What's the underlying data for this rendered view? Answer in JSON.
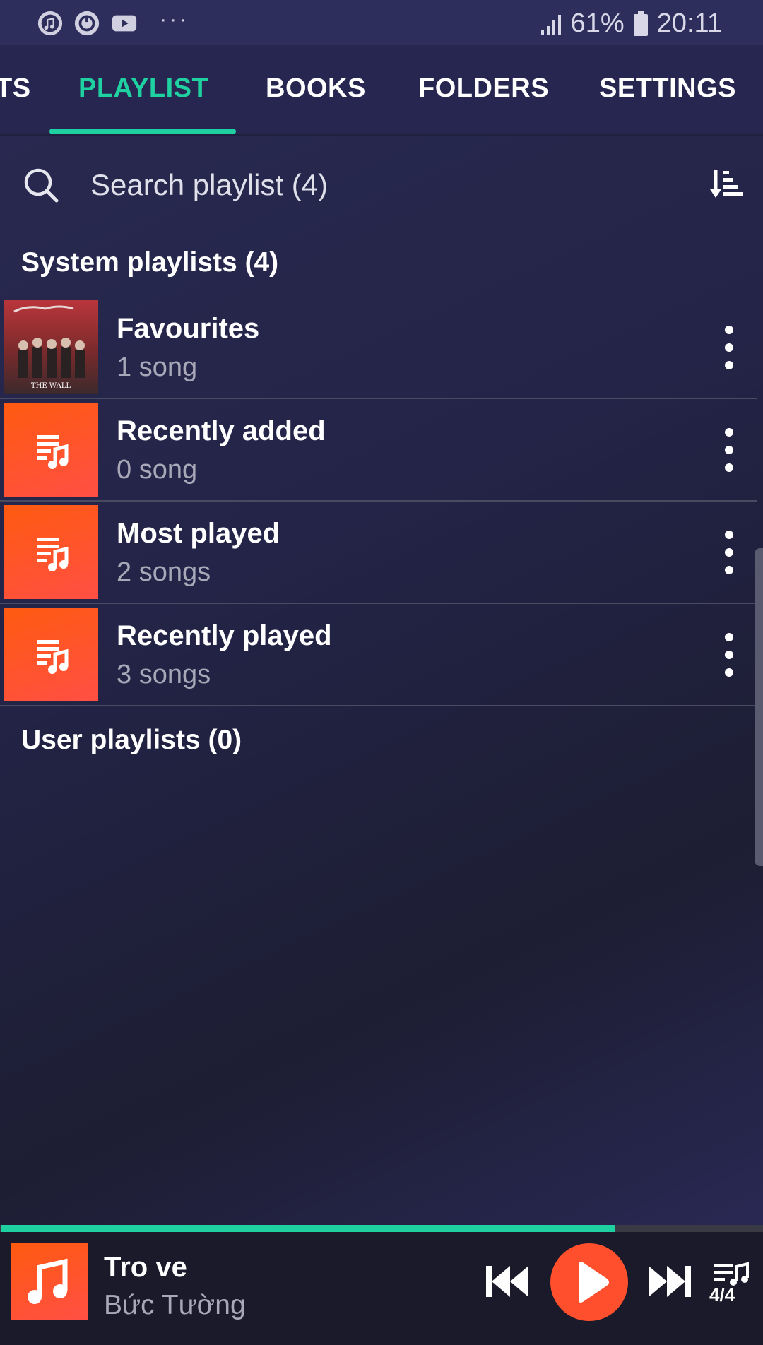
{
  "status_bar": {
    "icons": [
      "music-app-icon",
      "sync-icon",
      "youtube-icon"
    ],
    "more": "···",
    "battery": "61%",
    "time": "20:11"
  },
  "tabs": [
    {
      "label": "TS"
    },
    {
      "label": "PLAYLIST",
      "active": true
    },
    {
      "label": "BOOKS"
    },
    {
      "label": "FOLDERS"
    },
    {
      "label": "SETTINGS"
    }
  ],
  "search": {
    "placeholder": "Search playlist (4)"
  },
  "sections": {
    "system": "System playlists (4)",
    "user": "User playlists (0)"
  },
  "playlists": [
    {
      "title": "Favourites",
      "subtitle": "1 song",
      "thumb": "album-art",
      "album_text": "THE WALL"
    },
    {
      "title": "Recently added",
      "subtitle": "0 song",
      "thumb": "playlist-music-icon"
    },
    {
      "title": "Most played",
      "subtitle": "2 songs",
      "thumb": "playlist-music-icon"
    },
    {
      "title": "Recently played",
      "subtitle": "3 songs",
      "thumb": "playlist-music-icon"
    }
  ],
  "player": {
    "title": "Tro ve",
    "artist": "Bức Tường",
    "progress": 0.805,
    "queue": "4/4"
  },
  "colors": {
    "accent": "#1fd1a0",
    "orange": "#ff5a10",
    "play_button": "#ff4f2c"
  }
}
